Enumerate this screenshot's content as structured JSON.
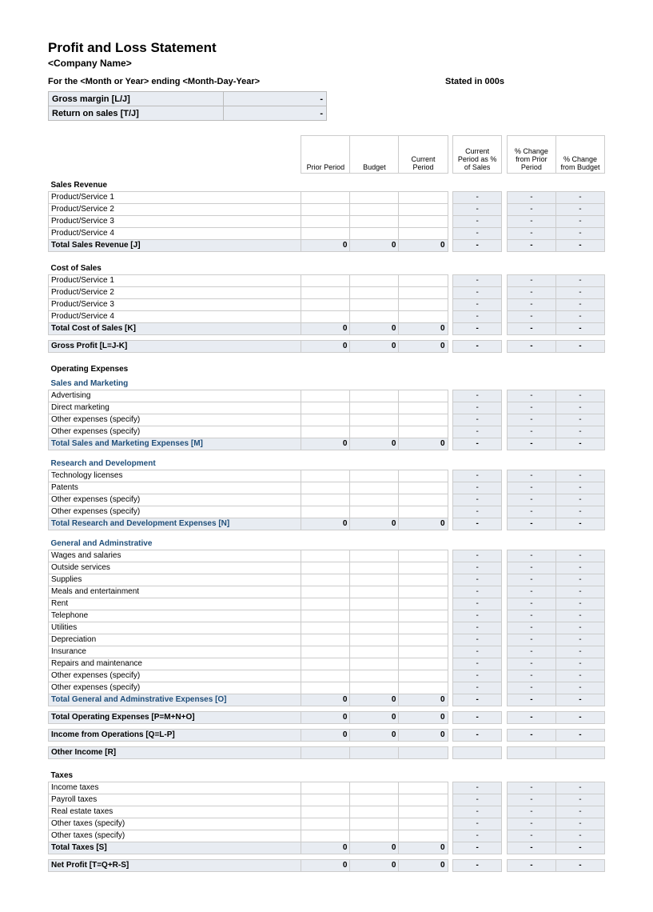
{
  "title": "Profit and Loss Statement",
  "company": "<Company Name>",
  "period_line": "For the <Month or Year> ending <Month-Day-Year>",
  "stated": "Stated in 000s",
  "metrics": {
    "gross_margin_label": "Gross margin  [L/J]",
    "gross_margin_value": "-",
    "return_on_sales_label": "Return on sales  [T/J]",
    "return_on_sales_value": "-"
  },
  "headers": {
    "prior_period": "Prior Period",
    "budget": "Budget",
    "current_period": "Current Period",
    "pct_of_sales": "Current Period as % of Sales",
    "pct_change_prior": "% Change from Prior Period",
    "pct_change_budget": "% Change from Budget"
  },
  "sections": {
    "sales_revenue": {
      "title": "Sales Revenue",
      "rows": [
        "Product/Service 1",
        "Product/Service 2",
        "Product/Service 3",
        "Product/Service 4"
      ],
      "total_label": "Total Sales Revenue  [J]",
      "total": [
        "0",
        "0",
        "0",
        "-",
        "-",
        "-"
      ]
    },
    "cost_of_sales": {
      "title": "Cost of Sales",
      "rows": [
        "Product/Service 1",
        "Product/Service 2",
        "Product/Service 3",
        "Product/Service 4"
      ],
      "total_label": "Total Cost of Sales  [K]",
      "total": [
        "0",
        "0",
        "0",
        "-",
        "-",
        "-"
      ]
    },
    "gross_profit": {
      "label": "Gross Profit  [L=J-K]",
      "values": [
        "0",
        "0",
        "0",
        "-",
        "-",
        "-"
      ]
    },
    "operating_expenses": {
      "title": "Operating Expenses",
      "sales_marketing": {
        "title": "Sales and Marketing",
        "rows": [
          "Advertising",
          "Direct marketing",
          "Other expenses (specify)",
          "Other expenses (specify)"
        ],
        "total_label": "Total Sales and Marketing Expenses  [M]",
        "total": [
          "0",
          "0",
          "0",
          "-",
          "-",
          "-"
        ]
      },
      "research_dev": {
        "title": "Research and Development",
        "rows": [
          "Technology licenses",
          "Patents",
          "Other expenses (specify)",
          "Other expenses (specify)"
        ],
        "total_label": "Total Research and Development Expenses  [N]",
        "total": [
          "0",
          "0",
          "0",
          "-",
          "-",
          "-"
        ]
      },
      "general_admin": {
        "title": "General and Adminstrative",
        "rows": [
          "Wages and salaries",
          "Outside services",
          "Supplies",
          "Meals and entertainment",
          "Rent",
          "Telephone",
          "Utilities",
          "Depreciation",
          "Insurance",
          "Repairs and maintenance",
          "Other expenses (specify)",
          "Other expenses (specify)"
        ],
        "total_label": "Total General and Adminstrative Expenses  [O]",
        "total": [
          "0",
          "0",
          "0",
          "-",
          "-",
          "-"
        ]
      },
      "total_label": "Total Operating Expenses  [P=M+N+O]",
      "total": [
        "0",
        "0",
        "0",
        "-",
        "-",
        "-"
      ]
    },
    "income_ops": {
      "label": "Income from Operations  [Q=L-P]",
      "values": [
        "0",
        "0",
        "0",
        "-",
        "-",
        "-"
      ]
    },
    "other_income": {
      "label": "Other Income  [R]",
      "values": [
        "",
        "",
        "",
        "",
        "",
        ""
      ]
    },
    "taxes": {
      "title": "Taxes",
      "rows": [
        "Income taxes",
        "Payroll taxes",
        "Real estate taxes",
        "Other taxes (specify)",
        "Other taxes (specify)"
      ],
      "total_label": "Total Taxes  [S]",
      "total": [
        "0",
        "0",
        "0",
        "-",
        "-",
        "-"
      ]
    },
    "net_profit": {
      "label": "Net Profit  [T=Q+R-S]",
      "values": [
        "0",
        "0",
        "0",
        "-",
        "-",
        "-"
      ]
    }
  },
  "dash": "-"
}
